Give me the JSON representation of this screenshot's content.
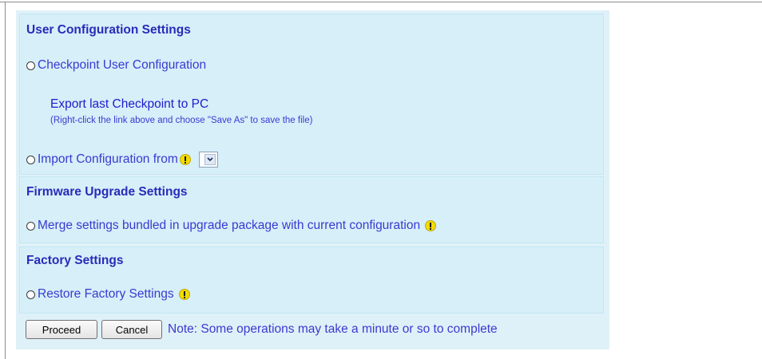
{
  "user_config": {
    "title": "User Configuration Settings",
    "checkpoint_label": "Checkpoint User Configuration",
    "export_link": "Export last Checkpoint to PC",
    "export_hint": "(Right-click the link above and choose \"Save As\" to save the file)",
    "import_label": "Import Configuration from",
    "import_selected": ""
  },
  "firmware": {
    "title": "Firmware Upgrade Settings",
    "merge_label": "Merge settings bundled in upgrade package with current configuration"
  },
  "factory": {
    "title": "Factory Settings",
    "restore_label": "Restore Factory Settings"
  },
  "actions": {
    "proceed_label": "Proceed",
    "cancel_label": "Cancel",
    "note": "Note: Some operations may take a minute or so to complete"
  },
  "icons": {
    "warning": "warning-icon",
    "radio": "radio-button",
    "dropdown_arrow": "chevron-down-icon"
  },
  "colors": {
    "panel_bg": "#dff1f8",
    "section_bg": "#d6eff9",
    "title": "#2a2ab8",
    "text": "#3a3ad0",
    "link": "#1c1ccc",
    "warning": "#f2dc00"
  }
}
